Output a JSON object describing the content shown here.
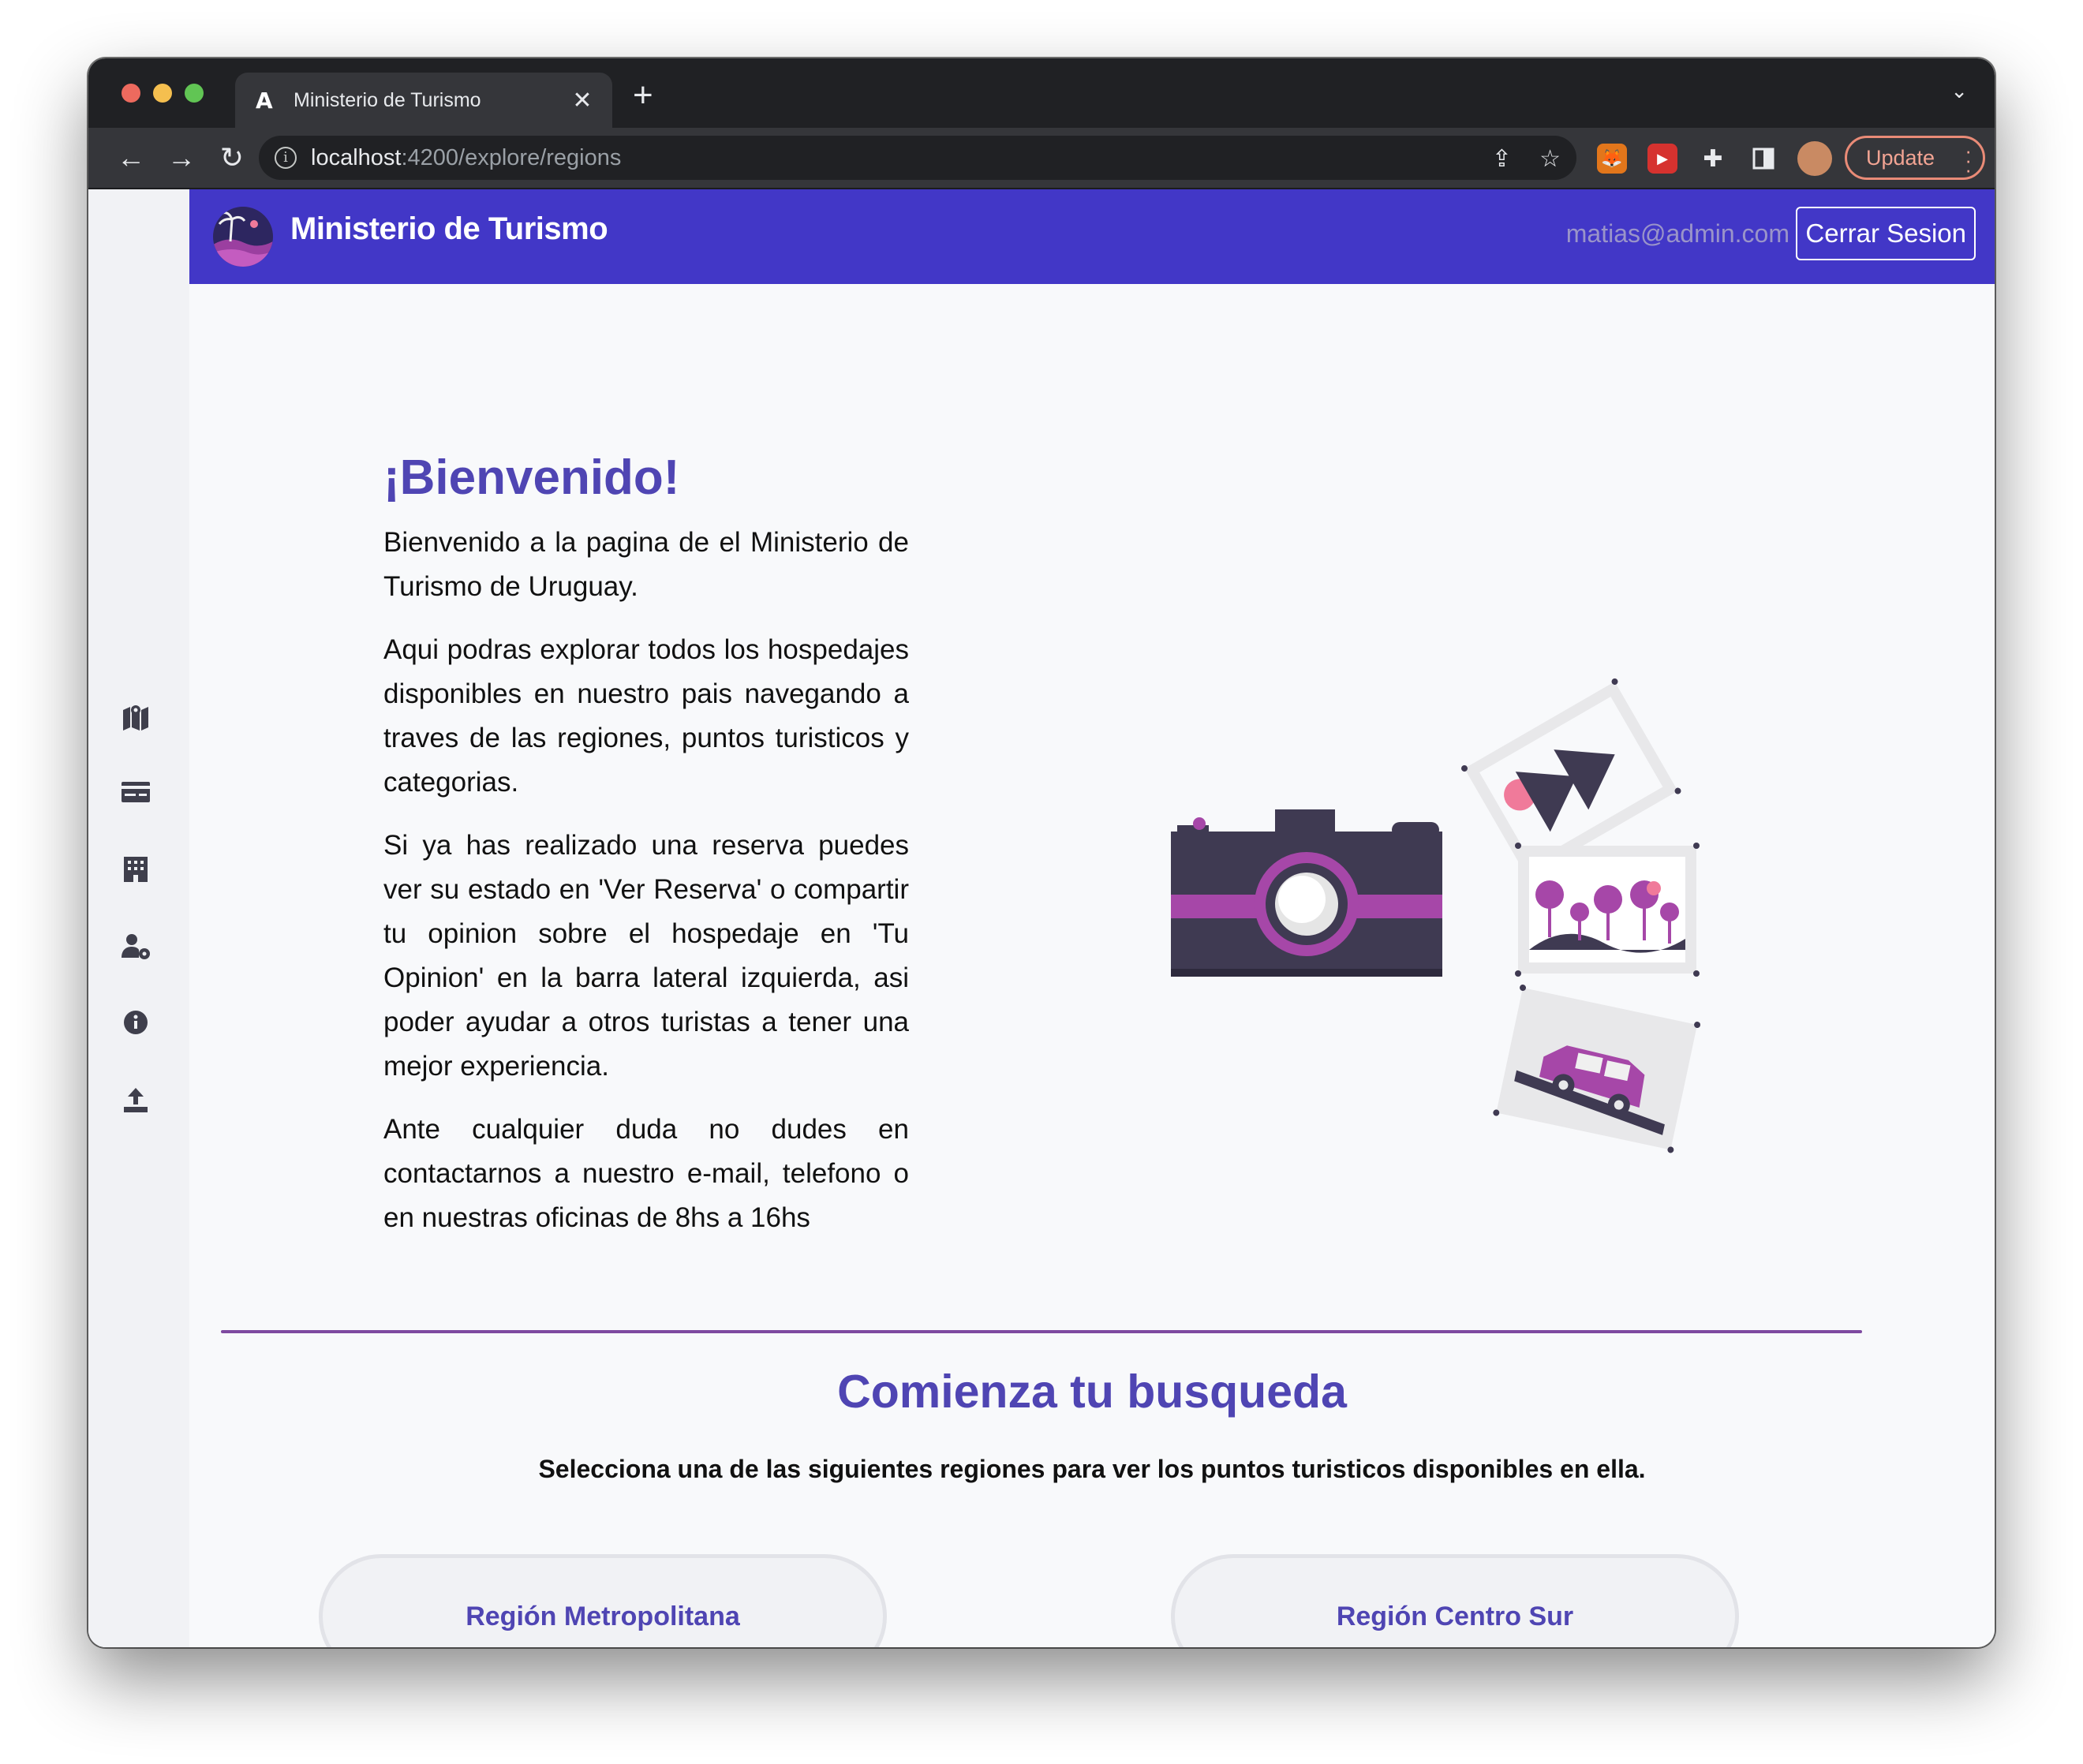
{
  "browser": {
    "tab_title": "Ministerio de Turismo",
    "tab_favicon": "A",
    "url_host": "localhost",
    "url_path": ":4200/explore/regions",
    "update_label": "Update"
  },
  "header": {
    "brand": "Ministerio de Turismo",
    "user_email": "matias@admin.com",
    "logout_label": "Cerrar Sesion"
  },
  "sidebar": {
    "items": [
      {
        "icon": "map-icon"
      },
      {
        "icon": "card-icon"
      },
      {
        "icon": "hotel-icon"
      },
      {
        "icon": "user-settings-icon"
      },
      {
        "icon": "info-icon"
      },
      {
        "icon": "upload-icon"
      }
    ]
  },
  "welcome": {
    "title": "¡Bienvenido!",
    "paragraphs": [
      "Bienvenido a la pagina de el Ministerio de Turismo de Uruguay.",
      "Aqui podras explorar todos los hospedajes disponibles en nuestro pais navegando a traves de las regiones, puntos turisticos y categorias.",
      "Si ya has realizado una reserva puedes ver su estado en 'Ver Reserva' o compartir tu opinion sobre el hospedaje en 'Tu Opinion' en la barra lateral izquierda, asi poder ayudar a otros turistas a tener una mejor experiencia.",
      "Ante cualquier duda no dudes en contactarnos a nuestro e-mail, telefono o en nuestras oficinas de 8hs a 16hs"
    ]
  },
  "search": {
    "title": "Comienza tu busqueda",
    "subtitle": "Selecciona una de las siguientes regiones para ver los puntos turisticos disponibles en ella.",
    "regions": [
      {
        "label": "Región Metropolitana"
      },
      {
        "label": "Región Centro Sur"
      }
    ]
  },
  "colors": {
    "header_bg": "#4237c7",
    "accent": "#4f45b3",
    "divider": "#7e4aa0",
    "illustration_purple": "#a647a8",
    "illustration_dark": "#3f3a52"
  }
}
